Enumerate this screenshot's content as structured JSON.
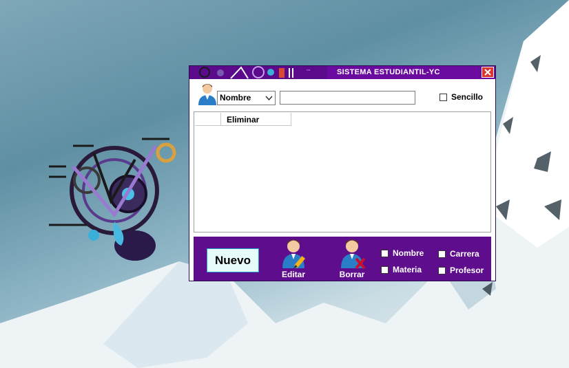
{
  "window": {
    "title": "SISTEMA ESTUDIANTIL-YC",
    "close_symbol": "✕"
  },
  "search": {
    "filter_selected": "Nombre",
    "query_value": "",
    "sencillo_label": "Sencillo",
    "sencillo_checked": false
  },
  "grid": {
    "columns": [
      "",
      "Eliminar"
    ],
    "rows": []
  },
  "actions": {
    "nuevo_label": "Nuevo",
    "editar_label": "Editar",
    "borrar_label": "Borrar"
  },
  "options": {
    "nombre": {
      "label": "Nombre",
      "checked": false
    },
    "materia": {
      "label": "Materia",
      "checked": false
    },
    "carrera": {
      "label": "Carrera",
      "checked": false
    },
    "profesor": {
      "label": "Profesor",
      "checked": false
    }
  },
  "icons": [
    "user-icon",
    "chevron-down-icon",
    "close-icon",
    "edit-user-icon",
    "delete-user-icon",
    "gear-art-logo"
  ],
  "colors": {
    "titlebar": "#6a0a9e",
    "panel": "#5e0e8c",
    "close": "#d9362e",
    "nuevo_bg": "#e8fbfb"
  }
}
